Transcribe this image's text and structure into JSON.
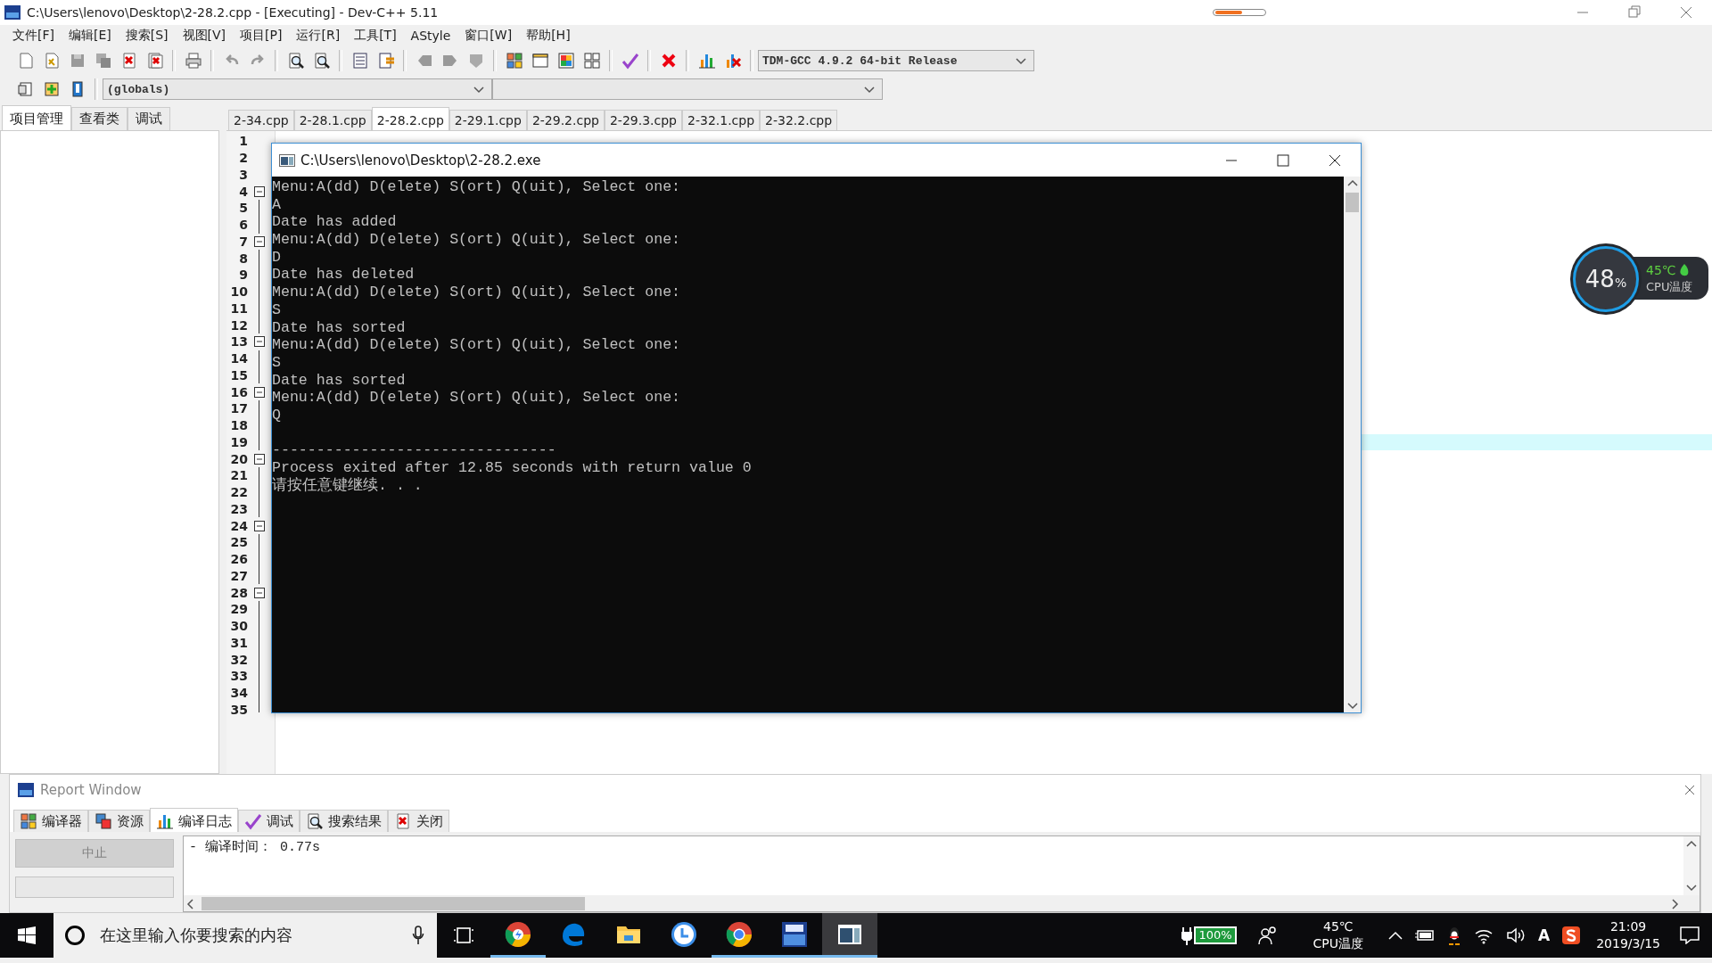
{
  "window": {
    "title": "C:\\Users\\lenovo\\Desktop\\2-28.2.cpp - [Executing] - Dev-C++ 5.11"
  },
  "menu": [
    "文件[F]",
    "编辑[E]",
    "搜索[S]",
    "视图[V]",
    "项目[P]",
    "运行[R]",
    "工具[T]",
    "AStyle",
    "窗口[W]",
    "帮助[H]"
  ],
  "compiler_select": {
    "value": "TDM-GCC 4.9.2 64-bit Release"
  },
  "scope_select": {
    "value": "(globals)"
  },
  "side_tabs": [
    {
      "label": "项目管理",
      "selected": true
    },
    {
      "label": "查看类",
      "selected": false
    },
    {
      "label": "调试",
      "selected": false
    }
  ],
  "file_tabs": [
    {
      "label": "2-34.cpp",
      "selected": false
    },
    {
      "label": "2-28.1.cpp",
      "selected": false
    },
    {
      "label": "2-28.2.cpp",
      "selected": true
    },
    {
      "label": "2-29.1.cpp",
      "selected": false
    },
    {
      "label": "2-29.2.cpp",
      "selected": false
    },
    {
      "label": "2-29.3.cpp",
      "selected": false
    },
    {
      "label": "2-32.1.cpp",
      "selected": false
    },
    {
      "label": "2-32.2.cpp",
      "selected": false
    }
  ],
  "gutter": {
    "lines": [
      {
        "number": "1",
        "fold": false,
        "active": false
      },
      {
        "number": "2",
        "fold": false,
        "active": false
      },
      {
        "number": "3",
        "fold": false,
        "active": false
      },
      {
        "number": "4",
        "fold": true,
        "active": false
      },
      {
        "number": "5",
        "fold": false,
        "active": false
      },
      {
        "number": "6",
        "fold": false,
        "active": false
      },
      {
        "number": "7",
        "fold": true,
        "active": false
      },
      {
        "number": "8",
        "fold": false,
        "active": false
      },
      {
        "number": "9",
        "fold": false,
        "active": false
      },
      {
        "number": "10",
        "fold": false,
        "active": false
      },
      {
        "number": "11",
        "fold": false,
        "active": false
      },
      {
        "number": "12",
        "fold": false,
        "active": false
      },
      {
        "number": "13",
        "fold": true,
        "active": false
      },
      {
        "number": "14",
        "fold": false,
        "active": false
      },
      {
        "number": "15",
        "fold": false,
        "active": false
      },
      {
        "number": "16",
        "fold": true,
        "active": false
      },
      {
        "number": "17",
        "fold": false,
        "active": false
      },
      {
        "number": "18",
        "fold": false,
        "active": false
      },
      {
        "number": "19",
        "fold": false,
        "active": true
      },
      {
        "number": "20",
        "fold": true,
        "active": false
      },
      {
        "number": "21",
        "fold": false,
        "active": false
      },
      {
        "number": "22",
        "fold": false,
        "active": false
      },
      {
        "number": "23",
        "fold": false,
        "active": false
      },
      {
        "number": "24",
        "fold": true,
        "active": false
      },
      {
        "number": "25",
        "fold": false,
        "active": false
      },
      {
        "number": "26",
        "fold": false,
        "active": false
      },
      {
        "number": "27",
        "fold": false,
        "active": false
      },
      {
        "number": "28",
        "fold": true,
        "active": false
      },
      {
        "number": "29",
        "fold": false,
        "active": false
      },
      {
        "number": "30",
        "fold": false,
        "active": false
      },
      {
        "number": "31",
        "fold": false,
        "active": false
      },
      {
        "number": "32",
        "fold": false,
        "active": false
      },
      {
        "number": "33",
        "fold": false,
        "active": false
      },
      {
        "number": "34",
        "fold": false,
        "active": false
      },
      {
        "number": "35",
        "fold": false,
        "active": false
      }
    ]
  },
  "console": {
    "title": "C:\\Users\\lenovo\\Desktop\\2-28.2.exe",
    "lines": [
      "Menu:A(dd) D(elete) S(ort) Q(uit), Select one:",
      "A",
      "Date has added",
      "Menu:A(dd) D(elete) S(ort) Q(uit), Select one:",
      "D",
      "Date has deleted",
      "Menu:A(dd) D(elete) S(ort) Q(uit), Select one:",
      "S",
      "Date has sorted",
      "Menu:A(dd) D(elete) S(ort) Q(uit), Select one:",
      "S",
      "Date has sorted",
      "Menu:A(dd) D(elete) S(ort) Q(uit), Select one:",
      "Q"
    ],
    "exit_lines": [
      "--------------------------------",
      "Process exited after 12.85 seconds with return value 0",
      "请按任意键继续. . ."
    ]
  },
  "cpu_widget": {
    "usage": "48",
    "unit": "%",
    "temperature": "45℃",
    "label": "CPU温度"
  },
  "report": {
    "title": "Report Window",
    "tabs": [
      {
        "label": "编译器",
        "kind": "grid",
        "selected": false
      },
      {
        "label": "资源",
        "kind": "resources",
        "selected": false
      },
      {
        "label": "编译日志",
        "kind": "chart",
        "selected": true
      },
      {
        "label": "调试",
        "kind": "check",
        "selected": false
      },
      {
        "label": "搜索结果",
        "kind": "search",
        "selected": false
      },
      {
        "label": "关闭",
        "kind": "close",
        "selected": false
      }
    ],
    "abort_button": {
      "label": "中止",
      "disabled": true
    },
    "log": [
      "- 编译时间： 0.77s"
    ]
  },
  "taskbar": {
    "search": {
      "placeholder": "在这里输入你要搜索的内容"
    },
    "apps": [
      {
        "kind": "chrome-bolt",
        "running": true,
        "selected": false
      },
      {
        "kind": "edge",
        "running": false,
        "selected": false
      },
      {
        "kind": "folder",
        "running": false,
        "selected": false
      },
      {
        "kind": "clock",
        "running": false,
        "selected": false
      },
      {
        "kind": "chrome",
        "running": true,
        "selected": false
      },
      {
        "kind": "devcpp",
        "running": true,
        "selected": false
      },
      {
        "kind": "console",
        "running": true,
        "selected": true
      }
    ],
    "battery": "100%",
    "temperature": "45℃",
    "temperature_label": "CPU温度",
    "input_mode": "A",
    "time": "21:09",
    "date": "2019/3/15"
  }
}
